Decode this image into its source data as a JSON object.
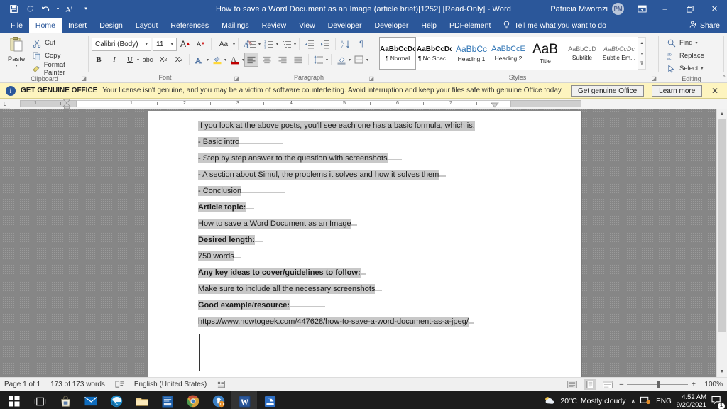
{
  "titlebar": {
    "document_title": "How to save a Word Document as an Image (article brief)[1252] [Read-Only]  -  Word",
    "user_name": "Patricia Mworozi",
    "avatar_initials": "PM",
    "qat": [
      {
        "name": "save-icon",
        "label": "Save"
      },
      {
        "name": "redo-icon",
        "label": "Redo"
      },
      {
        "name": "undo-icon",
        "label": "Undo"
      },
      {
        "name": "read-aloud-icon",
        "label": "Read Aloud"
      },
      {
        "name": "customize-quick-access-toolbar-icon",
        "label": "Customize Quick Access Toolbar"
      }
    ],
    "window": {
      "ribbon_display_options": "Ribbon Display Options",
      "minimize": "–",
      "restore": "❐",
      "close": "✕"
    }
  },
  "tabs": [
    {
      "label": "File",
      "active": false
    },
    {
      "label": "Home",
      "active": true
    },
    {
      "label": "Insert",
      "active": false
    },
    {
      "label": "Design",
      "active": false
    },
    {
      "label": "Layout",
      "active": false
    },
    {
      "label": "References",
      "active": false
    },
    {
      "label": "Mailings",
      "active": false
    },
    {
      "label": "Review",
      "active": false
    },
    {
      "label": "View",
      "active": false
    },
    {
      "label": "Developer",
      "active": false
    },
    {
      "label": "Developer",
      "active": false
    },
    {
      "label": "Help",
      "active": false
    },
    {
      "label": "PDFelement",
      "active": false
    }
  ],
  "tell_me": {
    "placeholder": "Tell me what you want to do"
  },
  "share": {
    "label": "Share"
  },
  "ribbon": {
    "clipboard": {
      "group_label": "Clipboard",
      "paste_label": "Paste",
      "commands": [
        {
          "label": "Cut",
          "icon": "scissors-icon"
        },
        {
          "label": "Copy",
          "icon": "copy-icon"
        },
        {
          "label": "Format Painter",
          "icon": "format-painter-icon"
        }
      ]
    },
    "font": {
      "group_label": "Font",
      "font_family": "Calibri (Body)",
      "font_size": "11",
      "buttons_row1": [
        {
          "label": "A",
          "name": "grow-font-button"
        },
        {
          "label": "A",
          "name": "shrink-font-button"
        },
        {
          "label": "Aa",
          "name": "change-case-button"
        },
        {
          "label": "✐",
          "name": "clear-formatting-button"
        }
      ],
      "buttons_row2": [
        {
          "label": "B",
          "name": "bold-button"
        },
        {
          "label": "I",
          "name": "italic-button"
        },
        {
          "label": "U",
          "name": "underline-button"
        },
        {
          "label": "abc",
          "name": "strikethrough-button"
        },
        {
          "label": "X₂",
          "name": "subscript-button"
        },
        {
          "label": "X²",
          "name": "superscript-button"
        },
        {
          "label": "A",
          "name": "text-effects-button"
        },
        {
          "label": "ab",
          "name": "text-highlight-color-button"
        },
        {
          "label": "A",
          "name": "font-color-button"
        }
      ]
    },
    "paragraph": {
      "group_label": "Paragraph",
      "row1": [
        "bullets-button",
        "numbering-button",
        "multilevel-list-button",
        "decrease-indent-button",
        "increase-indent-button",
        "sort-button",
        "show-formatting-marks-button"
      ],
      "row2": [
        "align-left-button",
        "align-center-button",
        "align-right-button",
        "justify-button",
        "line-spacing-button",
        "shading-button",
        "borders-button"
      ]
    },
    "styles": {
      "group_label": "Styles",
      "items": [
        {
          "preview": "AaBbCcDc",
          "name": "¶ Normal",
          "current": true,
          "color": "#111111",
          "bold": true
        },
        {
          "preview": "AaBbCcDc",
          "name": "¶ No Spac...",
          "current": false,
          "color": "#111111",
          "bold": true
        },
        {
          "preview": "AaBbCс",
          "name": "Heading 1",
          "current": false,
          "color": "#2e74b5",
          "bold": false
        },
        {
          "preview": "AaBbCcE",
          "name": "Heading 2",
          "current": false,
          "color": "#2e74b5",
          "bold": false
        },
        {
          "preview": "AaB",
          "name": "Title",
          "current": false,
          "color": "#111111",
          "bold": false
        },
        {
          "preview": "AaBbCcD",
          "name": "Subtitle",
          "current": false,
          "color": "#595959",
          "bold": false
        },
        {
          "preview": "AaBbCcDc",
          "name": "Subtle Em...",
          "current": false,
          "color": "#595959",
          "bold": false
        }
      ]
    },
    "editing": {
      "group_label": "Editing",
      "commands": [
        {
          "label": "Find",
          "icon": "search-icon",
          "caret": true
        },
        {
          "label": "Replace",
          "icon": "replace-icon",
          "caret": false
        },
        {
          "label": "Select",
          "icon": "select-icon",
          "caret": true
        }
      ],
      "collapse_ribbon": "^"
    }
  },
  "notification": {
    "badge": "GET GENUINE OFFICE",
    "message": "Your license isn't genuine, and you may be a victim of software counterfeiting. Avoid interruption and keep your files safe with genuine Office today.",
    "primary_button": "Get genuine Office",
    "secondary_button": "Learn more",
    "close": "✕",
    "info_icon": "i"
  },
  "ruler": {
    "numbers": [
      "1",
      "1",
      "2",
      "3",
      "4",
      "5",
      "6",
      "7"
    ]
  },
  "document": {
    "paragraphs": [
      {
        "text": "If you look at the above posts, you'll see each one has a basic formula, which is:",
        "bold": false
      },
      {
        "text": "- Basic intro",
        "bold": false
      },
      {
        "text": "- Step by step answer to the question with screenshots",
        "bold": false
      },
      {
        "text": "- A section about Simul, the problems it solves and how it solves them",
        "bold": false
      },
      {
        "text": "- Conclusion",
        "bold": false
      },
      {
        "text": "Article topic:",
        "bold": true
      },
      {
        "text": "How to save a Word Document as an Image",
        "bold": false
      },
      {
        "text": "Desired length:",
        "bold": true
      },
      {
        "text": "750 words",
        "bold": false
      },
      {
        "text": "Any key ideas to cover/guidelines to follow:",
        "bold": true
      },
      {
        "text": "Make sure to include all the necessary screenshots",
        "bold": false
      },
      {
        "text": "Good example/resource:",
        "bold": true
      },
      {
        "text": "https://www.howtogeek.com/447628/how-to-save-a-word-document-as-a-jpeg/",
        "bold": false
      }
    ],
    "highlight_color": "#c8c8c8"
  },
  "statusbar": {
    "page": "Page 1 of 1",
    "words": "173 of 173 words",
    "proofing_icon": "proofing-errors-icon",
    "language": "English (United States)",
    "accessibility_icon": "accessibility-icon",
    "views": [
      {
        "name": "read-mode-view-button",
        "selected": false
      },
      {
        "name": "print-layout-view-button",
        "selected": true
      },
      {
        "name": "web-layout-view-button",
        "selected": false
      }
    ],
    "zoom_out": "–",
    "zoom_in": "+",
    "zoom_level": "100%"
  },
  "taskbar": {
    "icons": [
      {
        "name": "start-button",
        "label": "Start"
      },
      {
        "name": "task-view-button",
        "label": "Task View"
      },
      {
        "name": "microsoft-store-icon",
        "label": "Microsoft Store"
      },
      {
        "name": "mail-icon",
        "label": "Mail"
      },
      {
        "name": "microsoft-edge-icon",
        "label": "Microsoft Edge"
      },
      {
        "name": "file-explorer-icon",
        "label": "File Explorer"
      },
      {
        "name": "teams-icon",
        "label": "App"
      },
      {
        "name": "google-chrome-icon",
        "label": "Google Chrome"
      },
      {
        "name": "update-icon",
        "label": "10"
      },
      {
        "name": "word-icon",
        "label": "Word"
      },
      {
        "name": "simul-docs-icon",
        "label": "App"
      }
    ],
    "tray": {
      "weather_temp": "20°C",
      "weather_desc": "Mostly cloudy",
      "show_hidden_icons": "∧",
      "language": "ENG",
      "time": "4:52 AM",
      "date": "9/20/2021",
      "notification_count": "1"
    }
  }
}
